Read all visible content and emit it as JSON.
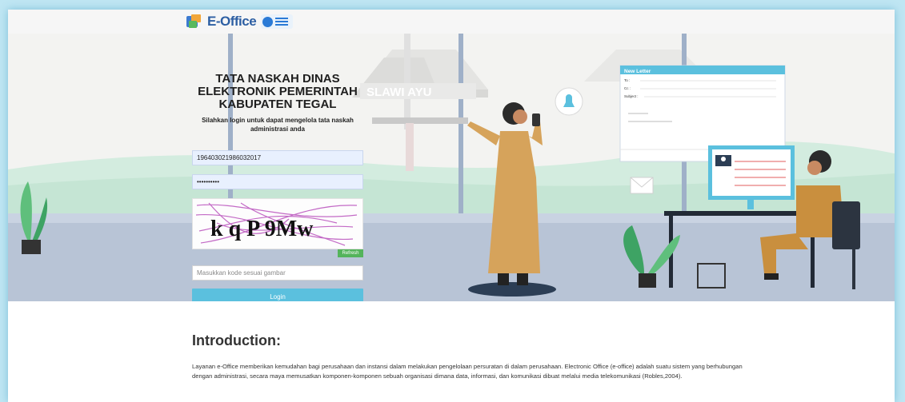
{
  "header": {
    "logo_text": "E-Office",
    "logo_subtext": "",
    "partner_logo": "seal-logo"
  },
  "hero": {
    "title": "TATA NASKAH DINAS ELEKTRONIK PEMERINTAH KABUPATEN TEGAL",
    "subtitle": "Silahkan login untuk dapat mengelola tata naskah administrasi anda",
    "signboard": "SLAWI AYU",
    "letter_window": {
      "title": "New Letter",
      "to_label": "To :",
      "cc_label": "Cc :",
      "subject_label": "Subject :"
    }
  },
  "login": {
    "username_value": "196403021986032017",
    "password_value": "••••••••••",
    "captcha_text": "k q P 9Mw",
    "refresh_label": "Refresh",
    "code_placeholder": "Masukkan kode sesuai gambar",
    "login_label": "Login"
  },
  "intro": {
    "heading": "Introduction:",
    "body": "Layanan e-Office memberikan kemudahan bagi perusahaan dan instansi dalam melakukan pengelolaan persuratan di dalam perusahaan. Electronic Office (e-office) adalah suatu sistem yang berhubungan dengan administrasi, secara maya memusatkan komponen-komponen sebuah organisasi dimana data, informasi, dan komunikasi dibuat melalui media telekomunikasi (Robles,2004)."
  },
  "colors": {
    "accent": "#5bc0de",
    "refresh": "#54b45b",
    "page_bg": "#bfe6f3"
  }
}
